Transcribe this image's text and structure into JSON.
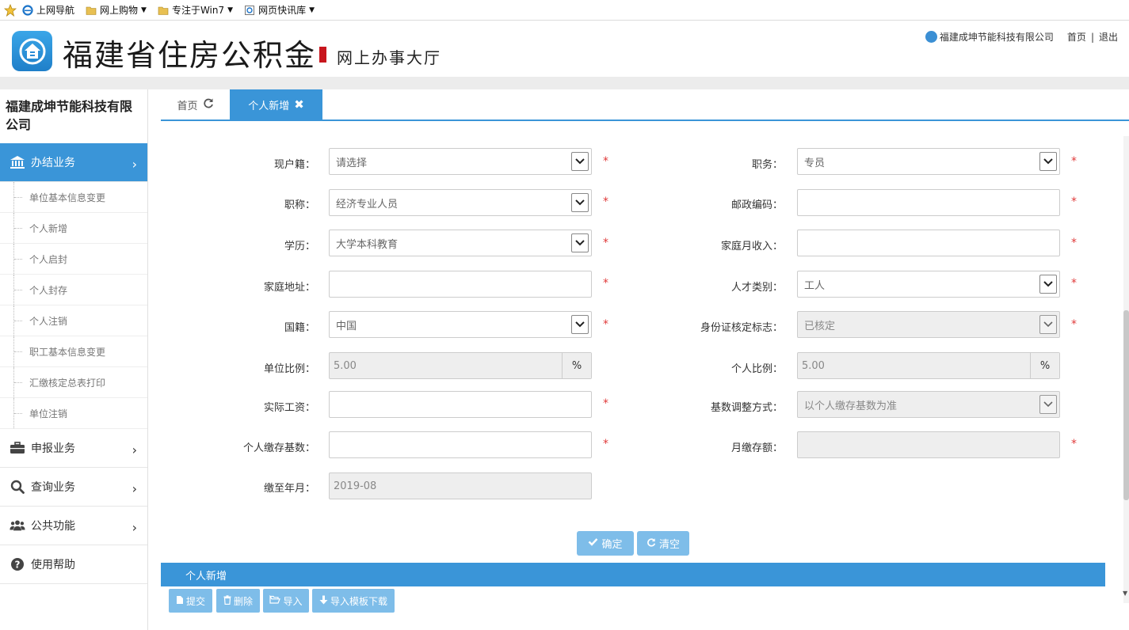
{
  "favorites": {
    "items": [
      {
        "label": "上网导航",
        "has_arrow": false
      },
      {
        "label": "网上购物",
        "has_arrow": true
      },
      {
        "label": "专注于Win7",
        "has_arrow": true
      },
      {
        "label": "网页快讯库",
        "has_arrow": true
      }
    ]
  },
  "header": {
    "title": "福建省住房公积金",
    "subtitle": "网上办事大厅",
    "company": "福建成坤节能科技有限公司",
    "home_link": "首页",
    "separator": "|",
    "logout_link": "退出"
  },
  "sidebar": {
    "company": "福建成坤节能科技有限公司",
    "menus": [
      {
        "label": "办结业务",
        "icon": "bank-icon",
        "active": true
      },
      {
        "label": "申报业务",
        "icon": "briefcase-icon"
      },
      {
        "label": "查询业务",
        "icon": "search-icon"
      },
      {
        "label": "公共功能",
        "icon": "users-icon"
      },
      {
        "label": "使用帮助",
        "icon": "help-icon"
      }
    ],
    "sub_items": [
      "单位基本信息变更",
      "个人新增",
      "个人启封",
      "个人封存",
      "个人注销",
      "职工基本信息变更",
      "汇缴核定总表打印",
      "单位注销"
    ]
  },
  "tabs": {
    "home": "首页",
    "current": "个人新增"
  },
  "form": {
    "left": [
      {
        "label": "现户籍：",
        "value": "请选择",
        "type": "select",
        "required": true
      },
      {
        "label": "职称：",
        "value": "经济专业人员",
        "type": "select",
        "required": true
      },
      {
        "label": "学历：",
        "value": "大学本科教育",
        "type": "select",
        "required": true
      },
      {
        "label": "家庭地址：",
        "value": "",
        "type": "text",
        "required": true
      },
      {
        "label": "国籍：",
        "value": "中国",
        "type": "select",
        "required": true
      },
      {
        "label": "单位比例：",
        "value": "5.00",
        "type": "percent",
        "required": false,
        "unit": "%"
      },
      {
        "label": "实际工资：",
        "value": "",
        "type": "text",
        "required": true
      },
      {
        "label": "个人缴存基数：",
        "value": "",
        "type": "text",
        "required": true
      },
      {
        "label": "缴至年月：",
        "value": "2019-08",
        "type": "readonly",
        "required": false
      }
    ],
    "right": [
      {
        "label": "职务：",
        "value": "专员",
        "type": "select",
        "required": true
      },
      {
        "label": "邮政编码：",
        "value": "",
        "type": "text",
        "required": true
      },
      {
        "label": "家庭月收入：",
        "value": "",
        "type": "text",
        "required": true
      },
      {
        "label": "人才类别：",
        "value": "工人",
        "type": "select",
        "required": true
      },
      {
        "label": "身份证核定标志：",
        "value": "已核定",
        "type": "select-disabled",
        "required": true
      },
      {
        "label": "个人比例：",
        "value": "5.00",
        "type": "percent",
        "required": false,
        "unit": "%"
      },
      {
        "label": "基数调整方式：",
        "value": "以个人缴存基数为准",
        "type": "select-disabled",
        "required": false
      },
      {
        "label": "月缴存额：",
        "value": "",
        "type": "readonly",
        "required": true
      }
    ],
    "required_mark": "*",
    "confirm_label": "确定",
    "clear_label": "清空"
  },
  "section": {
    "title": "个人新增",
    "buttons": [
      {
        "label": "提交",
        "icon": "file-icon"
      },
      {
        "label": "删除",
        "icon": "trash-icon"
      },
      {
        "label": "导入",
        "icon": "folder-open-icon"
      },
      {
        "label": "导入模板下载",
        "icon": "download-icon"
      }
    ]
  },
  "colors": {
    "accent": "#3a95d8",
    "button_light": "#7ebde9",
    "required": "#e03a3a",
    "logo_bar": "#c8161d"
  }
}
